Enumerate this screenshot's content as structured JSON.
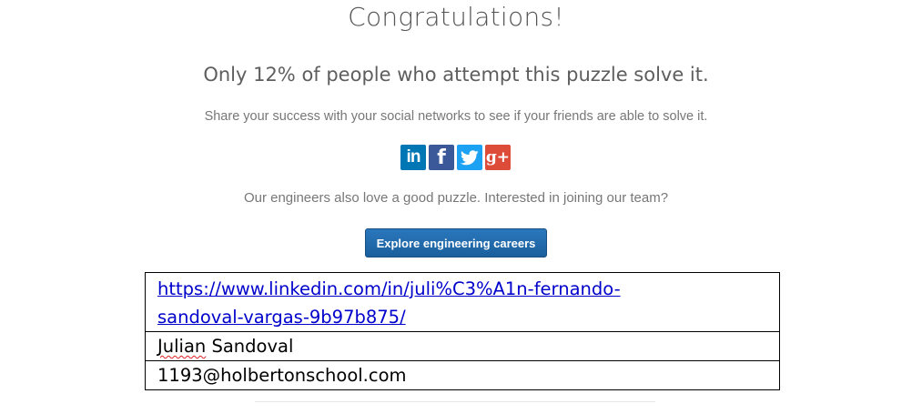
{
  "heading": "Congratulations!",
  "result": "Only 12% of people who attempt this puzzle solve it.",
  "share_prompt": "Share your success with your social networks to see if your friends are able to solve it.",
  "social": {
    "linkedin": "in",
    "facebook": "f",
    "googleplus": "g+"
  },
  "engineers_prompt": "Our engineers also love a good puzzle. Interested in joining our team?",
  "careers_button": "Explore engineering careers",
  "colors": {
    "button": "#1e67a8",
    "linkedin": "#0077b5",
    "facebook": "#3b5998",
    "twitter": "#1da1f2",
    "googleplus": "#dd4b39",
    "link": "#0000cc"
  },
  "table": {
    "link_line1": "https://www.linkedin.com/in/juli%C3%A1n-fernando-",
    "link_line2": "sandoval-vargas-9b97b875/",
    "name_first": "Julian",
    "name_last": " Sandoval",
    "email": "1193@holbertonschool.com"
  }
}
